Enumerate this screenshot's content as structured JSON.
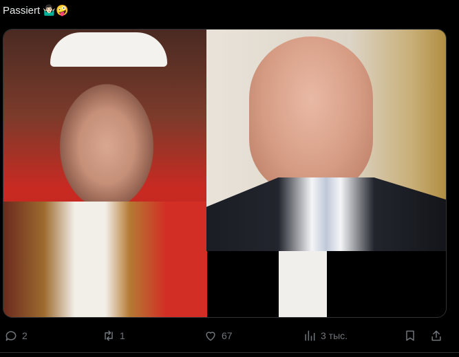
{
  "tweet": {
    "text": "Passiert",
    "emojis": "🤷🏻‍♂️🤪"
  },
  "actions": {
    "replies": "2",
    "retweets": "1",
    "likes": "67",
    "views": "3 тыс."
  },
  "icons": {
    "reply": "comment-icon",
    "retweet": "retweet-icon",
    "like": "heart-icon",
    "views": "views-icon",
    "bookmark": "bookmark-icon",
    "share": "share-icon"
  }
}
